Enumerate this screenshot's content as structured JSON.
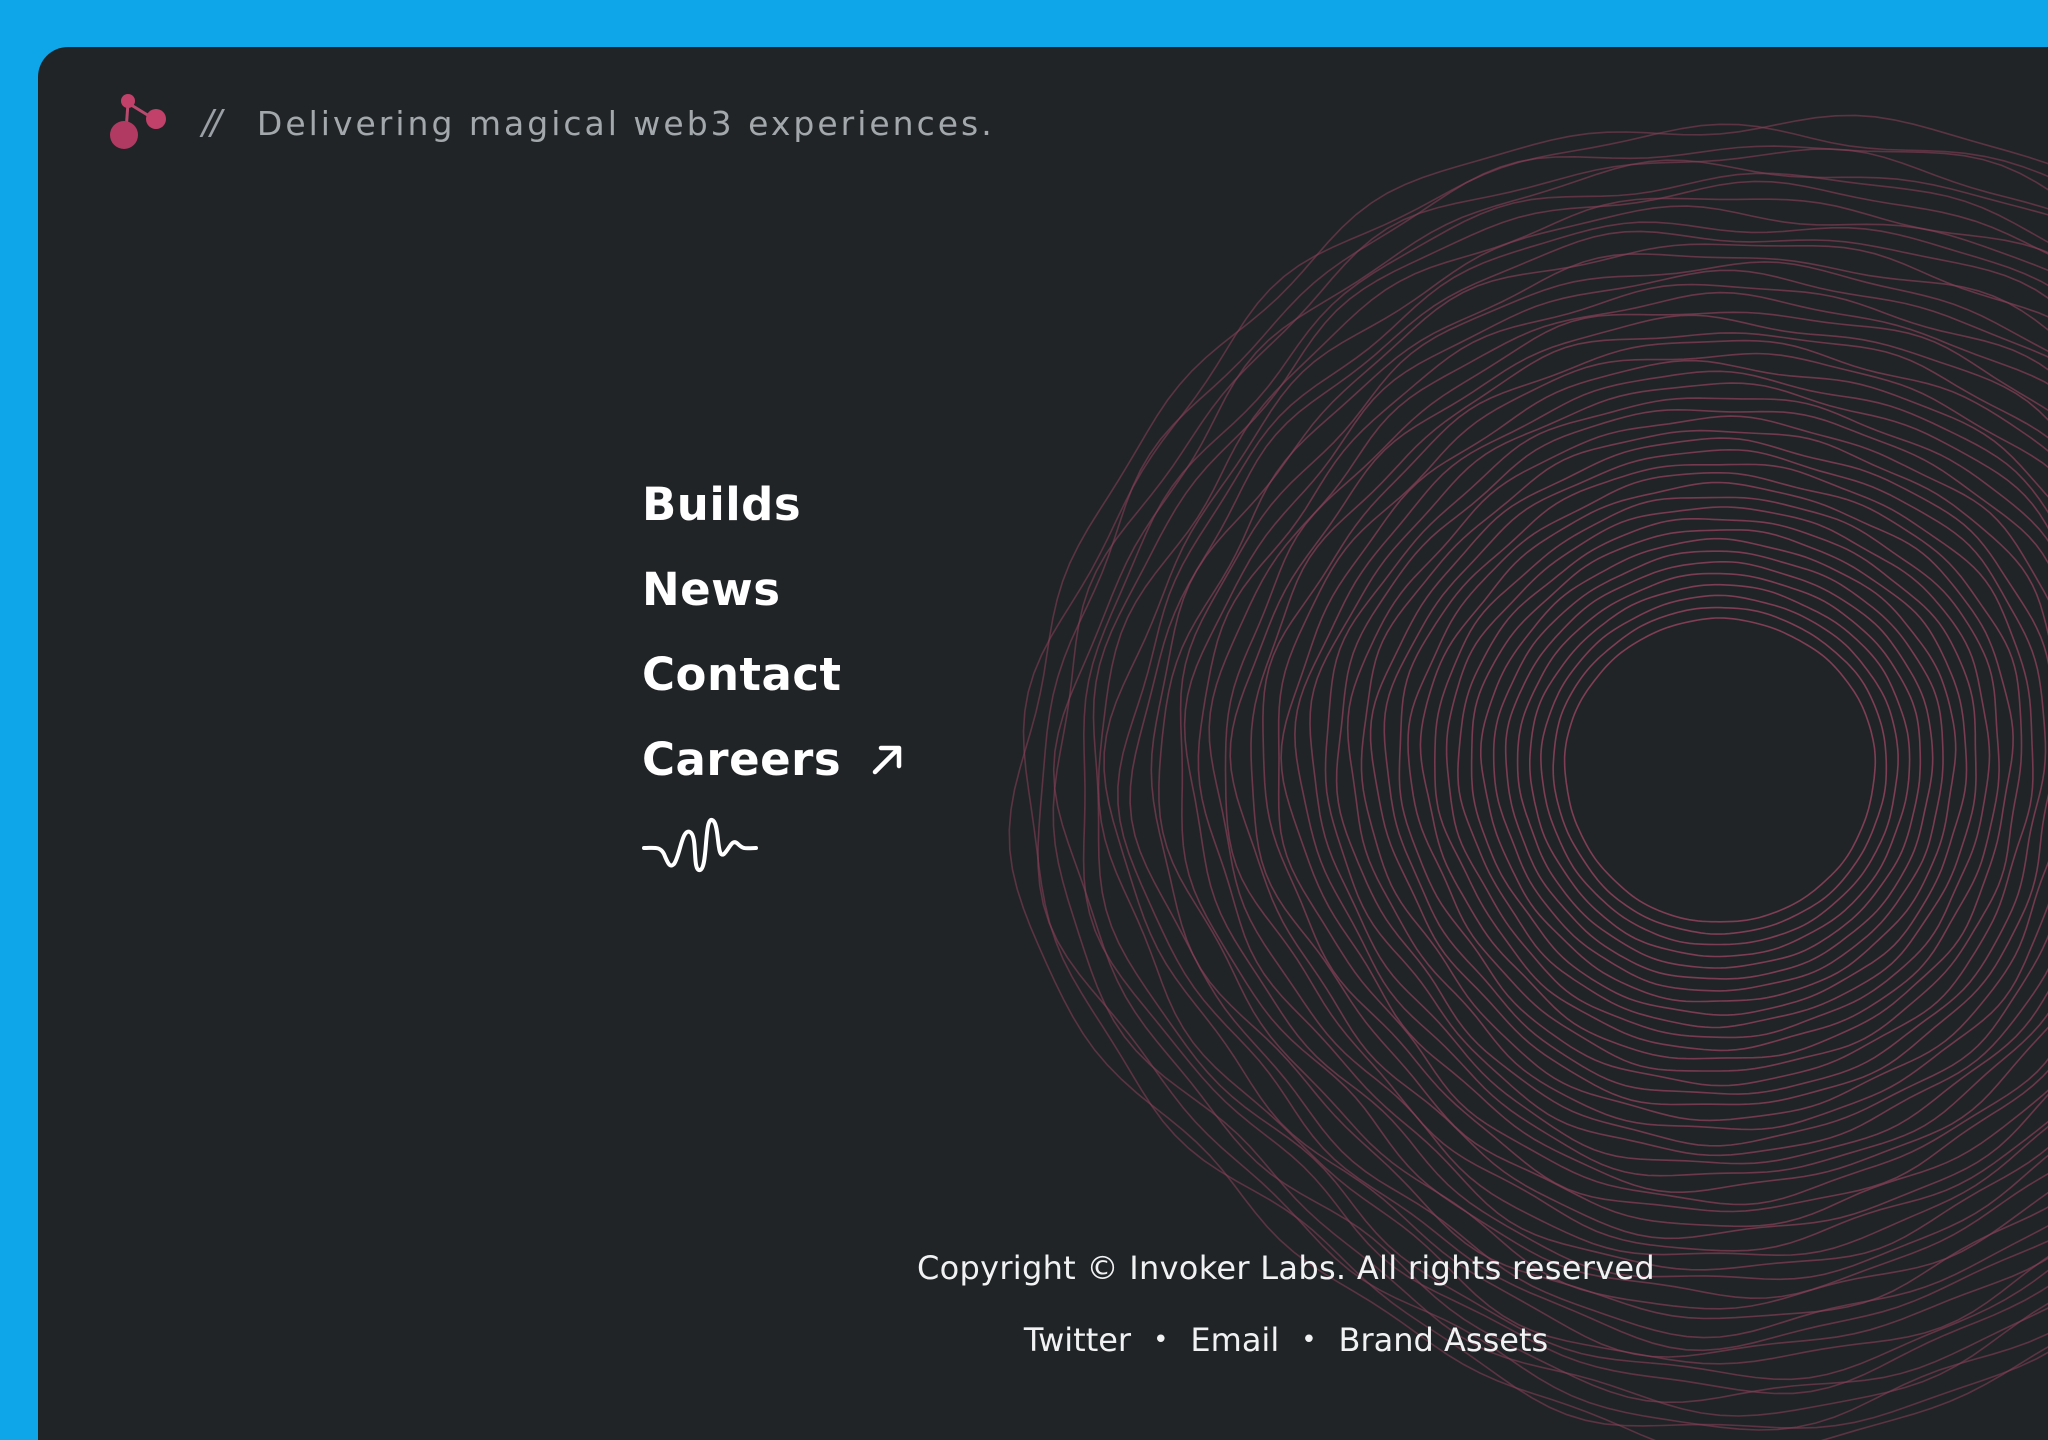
{
  "header": {
    "logo_icon": "molecule-logo-icon",
    "separator": "//",
    "tagline": "Delivering magical web3 experiences."
  },
  "nav": {
    "items": [
      {
        "label": "Builds"
      },
      {
        "label": "News"
      },
      {
        "label": "Contact"
      },
      {
        "label": "Careers",
        "icon": "arrow-up-right-icon"
      }
    ],
    "wave_icon": "waveform-icon"
  },
  "footer": {
    "copyright": "Copyright © Invoker Labs. All rights reserved",
    "links": [
      "Twitter",
      "Email",
      "Brand Assets"
    ],
    "separator": "•"
  },
  "colors": {
    "outer_background": "#0ea5e9",
    "panel_background": "#212427",
    "accent": "#c2416a",
    "ring_stroke": "#8a4159",
    "text": "#ffffff",
    "muted_text": "#a3a8ad"
  }
}
